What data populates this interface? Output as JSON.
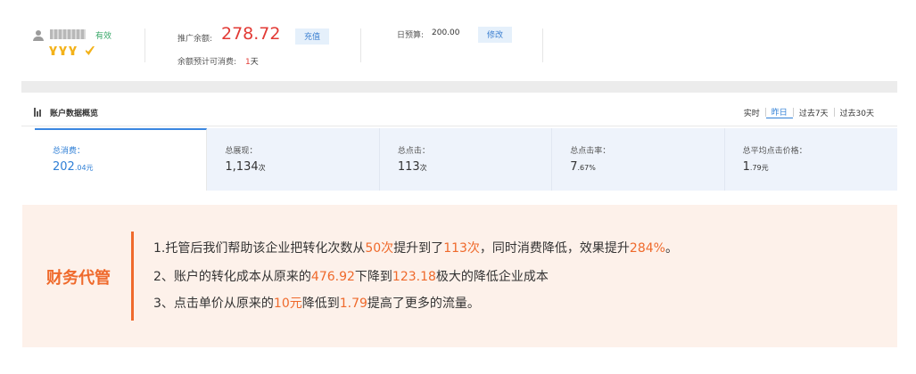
{
  "account": {
    "status": "有效",
    "balance_label": "推广余额:",
    "balance_value": "278.72",
    "recharge_label": "充值",
    "days_label": "余额预计可消费:",
    "days_num": "1",
    "days_unit": "天",
    "budget_label": "日预算:",
    "budget_value": "200.00",
    "edit_label": "修改"
  },
  "overview": {
    "title": "账户数据概览",
    "tabs": [
      {
        "label": "实时"
      },
      {
        "label": "昨日"
      },
      {
        "label": "过去7天"
      },
      {
        "label": "过去30天"
      }
    ],
    "metrics": [
      {
        "label": "总消费：",
        "value": "202",
        "value_small": ".04元"
      },
      {
        "label": "总展现：",
        "value": "1,134",
        "value_small": "次"
      },
      {
        "label": "总点击：",
        "value": "113",
        "value_small": "次"
      },
      {
        "label": "总点击率：",
        "value": "7",
        "value_small": ".67%"
      },
      {
        "label": "总平均点击价格：",
        "value": "1",
        "value_small": ".79元"
      }
    ]
  },
  "promo": {
    "title": "财务代管",
    "line1": {
      "a": "1.托管后我们帮助该企业把转化次数从",
      "b": "50次",
      "c": "提升到了",
      "d": "113次",
      "e": "，同时消费降低，效果提升",
      "f": "284%",
      "g": "。"
    },
    "line2": {
      "a": "2、账户的转化成本从原来的",
      "b": "476.92",
      "c": "下降到",
      "d": "123.18",
      "e": "极大的降低企业成本"
    },
    "line3": {
      "a": "3、点击单价从原来的",
      "b": "10元",
      "c": "降低到",
      "d": "1.79",
      "e": "提高了更多的流量。"
    }
  },
  "colors": {
    "accent_blue": "#2f7fd6",
    "accent_orange": "#ef6a2c",
    "balance_red": "#e23a35"
  },
  "icons": [
    "user-icon",
    "medal-icon",
    "bar-chart-icon"
  ]
}
